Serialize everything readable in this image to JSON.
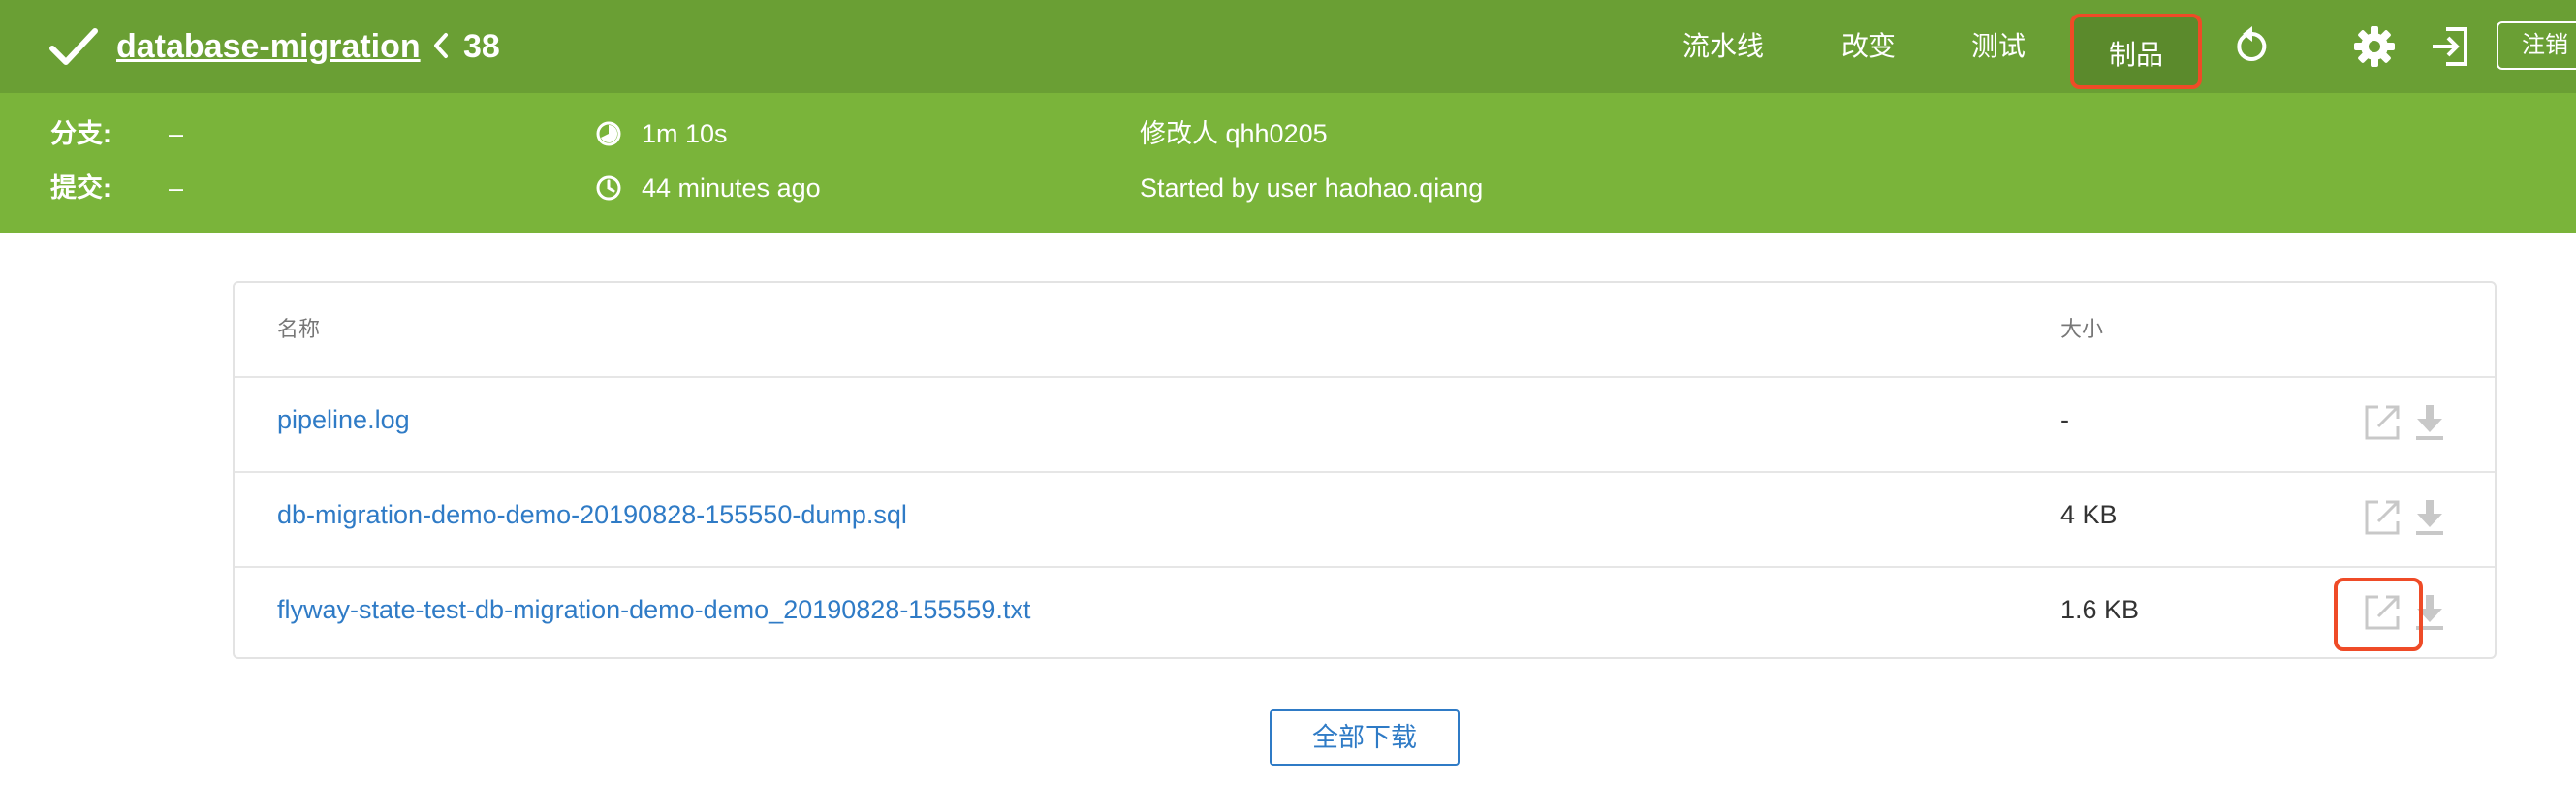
{
  "header": {
    "pipeline_name": "database-migration",
    "run_number": "38",
    "nav": {
      "pipeline": "流水线",
      "changes": "改变",
      "tests": "测试",
      "artifacts": "制品"
    },
    "logout_label": "注销"
  },
  "info": {
    "branch_label": "分支:",
    "branch_value": "–",
    "commit_label": "提交:",
    "commit_value": "–",
    "duration": "1m 10s",
    "time_ago": "44 minutes ago",
    "changed_by": "修改人 qhh0205",
    "started_by": "Started by user haohao.qiang"
  },
  "table": {
    "col_name": "名称",
    "col_size": "大小",
    "rows": [
      {
        "name": "pipeline.log",
        "size": "-"
      },
      {
        "name": "db-migration-demo-demo-20190828-155550-dump.sql",
        "size": "4 KB"
      },
      {
        "name": "flyway-state-test-db-migration-demo-demo_20190828-155559.txt",
        "size": "1.6 KB"
      }
    ]
  },
  "download_all_label": "全部下载",
  "colors": {
    "header_bg": "#6a9f34",
    "infobar_bg": "#7ab43a",
    "link": "#2f7bc6",
    "highlight": "#ef4b27"
  }
}
